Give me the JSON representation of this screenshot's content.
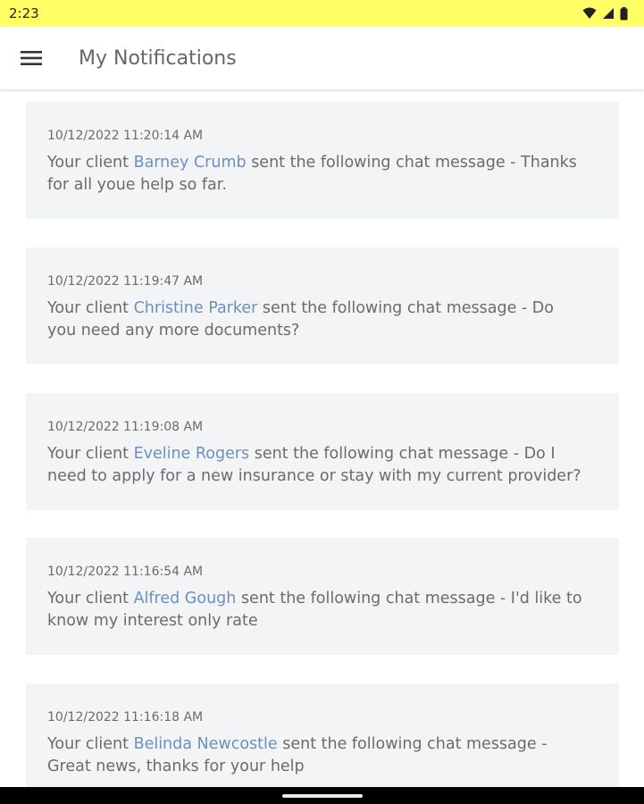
{
  "status_bar": {
    "time": "2:23",
    "icons": [
      "wifi-icon",
      "signal-icon",
      "battery-icon"
    ],
    "background": "#ffff66"
  },
  "app_bar": {
    "menu_icon": "hamburger-menu-icon",
    "title": "My Notifications"
  },
  "colors": {
    "client_link": "#6d8fbf",
    "card_background": "#f2f4f6",
    "text": "#6b6b6b"
  },
  "notifications": [
    {
      "timestamp": "10/12/2022 11:20:14 AM",
      "prefix": "Your client ",
      "client": "Barney Crumb",
      "line1_suffix": " sent the following chat message - Thanks",
      "line2": "for all youe help so far."
    },
    {
      "timestamp": "10/12/2022 11:19:47 AM",
      "prefix": "Your client ",
      "client": "Christine Parker",
      "line1_suffix": " sent the following chat message - Do",
      "line2": "you need any more documents?"
    },
    {
      "timestamp": "10/12/2022 11:19:08 AM",
      "prefix": "Your client ",
      "client": "Eveline Rogers",
      "line1_suffix": " sent the following chat message - Do I",
      "line2": "need to apply for a new insurance or stay with my current provider?"
    },
    {
      "timestamp": "10/12/2022 11:16:54 AM",
      "prefix": "Your client ",
      "client": "Alfred Gough",
      "line1_suffix": " sent the following chat message - I'd like to",
      "line2": "know my interest only rate"
    },
    {
      "timestamp": "10/12/2022 11:16:18 AM",
      "prefix": "Your client ",
      "client": "Belinda Newcostle",
      "line1_suffix": " sent the following chat message -",
      "line2": "Great news, thanks for your help"
    }
  ]
}
